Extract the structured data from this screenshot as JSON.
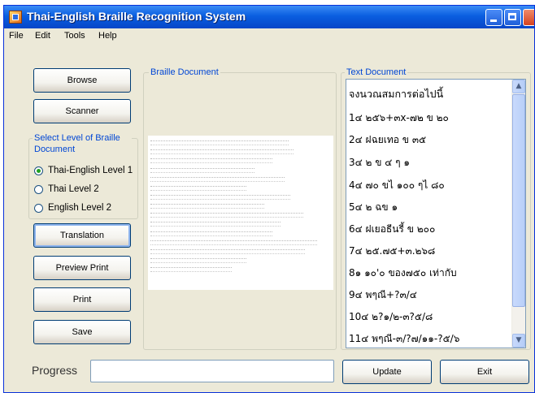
{
  "window": {
    "title": "Thai-English Braille Recognition System",
    "accent": "#0a5ee0"
  },
  "menu": [
    "File",
    "Edit",
    "Tools",
    "Help"
  ],
  "left_buttons": {
    "browse": "Browse",
    "scanner": "Scanner",
    "translation": "Translation",
    "preview_print": "Preview Print",
    "print": "Print",
    "save": "Save"
  },
  "level_group": {
    "legend": "Select Level of Braille Document",
    "options": [
      {
        "label": "Thai-English Level 1",
        "selected": true
      },
      {
        "label": "Thai Level 2",
        "selected": false
      },
      {
        "label": "English Level 2",
        "selected": false
      }
    ]
  },
  "braille_panel": {
    "legend": "Braille Document"
  },
  "text_panel": {
    "legend": "Text Document",
    "lines": [
      "จงนวณสมการต่อไปนี้",
      "1๔ ๒๕๖+๓x-๗๒ ข ๒๐",
      "2๔ ฝฉยเทอ ข ๓๕",
      "3๔ ๒ ข ๔ ๆ ๑",
      "4๔ ๗๐ ขไ ๑๐๐ ๆไ ๘๐",
      "5๔ ๒ ฉข ๑",
      "6๔ ฝเยอธีนรี้ ข ๒๐๐",
      "7๔ ๒๕.๗๕+๓.๒๖๘",
      "8๑ ๑๐'๐  ของ๗๕๐ เท่ากับ",
      "9๔ พๆณี+?๓/๔",
      "10๔ ๒?๑/๒-๓?๕/๘",
      "11๔ พๆณี-๓/?๗/๑๑-?๕/๖"
    ]
  },
  "bottom": {
    "progress_label": "Progress",
    "update": "Update",
    "exit": "Exit"
  }
}
